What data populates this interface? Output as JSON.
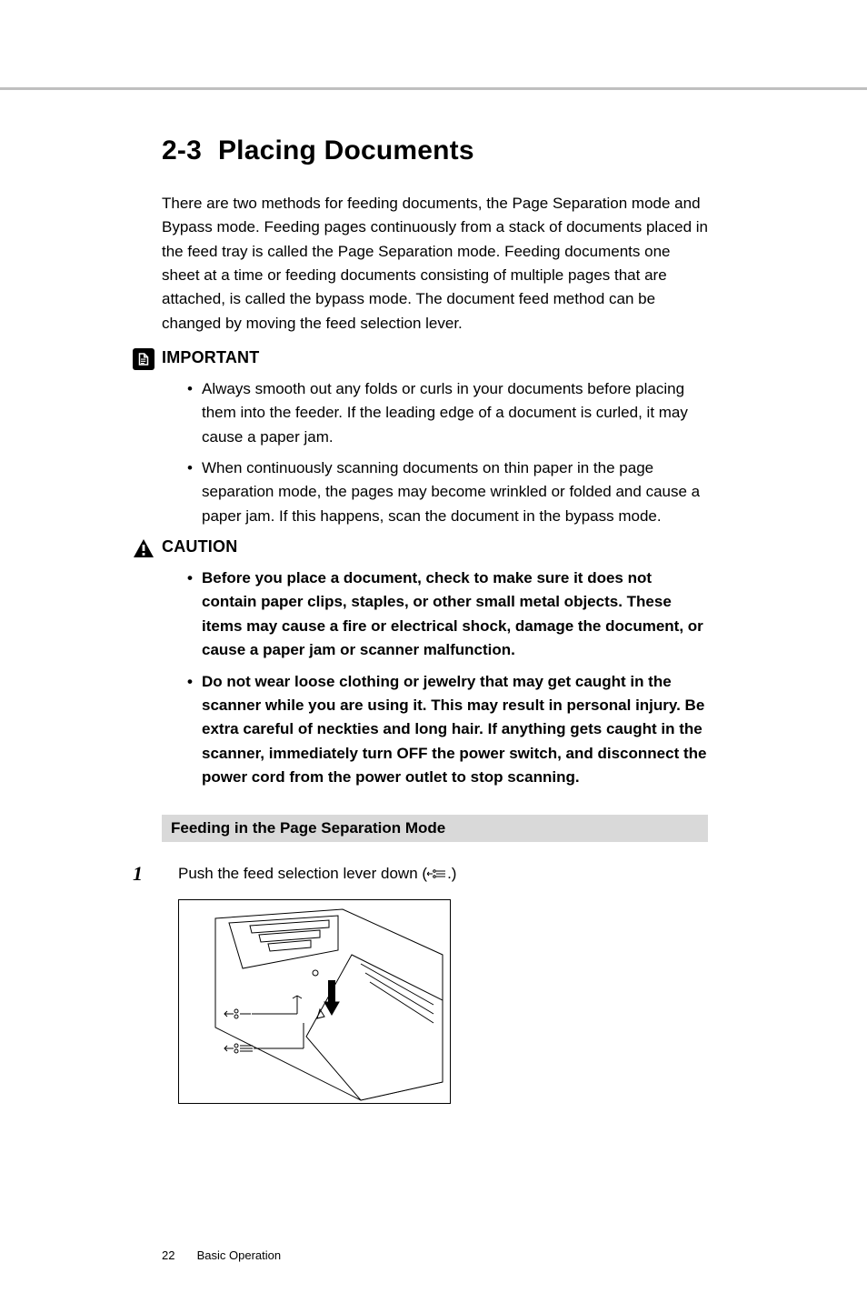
{
  "heading": {
    "number": "2-3",
    "title": "Placing Documents"
  },
  "intro": "There are two methods for feeding documents, the Page Separation mode and Bypass mode. Feeding pages continuously from a stack of documents placed in the feed tray is called the Page Separation mode. Feeding documents one sheet at a time or feeding documents consisting of multiple pages that are attached, is called the bypass mode. The document feed method can be changed by moving the feed selection lever.",
  "important": {
    "label": "IMPORTANT",
    "items": [
      "Always smooth out any folds or curls in your documents before placing them into the feeder. If the leading edge of a document is curled, it may cause a paper jam.",
      "When continuously scanning documents on thin paper in the page separation mode, the pages may become wrinkled or folded and cause a paper jam. If this happens, scan the document in the bypass mode."
    ]
  },
  "caution": {
    "label": "CAUTION",
    "items": [
      "Before you place a document, check to make sure it does not contain paper clips, staples, or other small metal objects. These items may cause a fire or electrical shock, damage the document, or cause a paper jam or scanner malfunction.",
      "Do not wear loose clothing or jewelry that may get caught in the scanner while you are using it. This may result in personal injury. Be extra careful of neckties and long hair. If anything gets caught in the scanner, immediately turn OFF the power switch, and disconnect the power cord from the power outlet to stop scanning."
    ]
  },
  "subheading": "Feeding in the Page Separation Mode",
  "step1": {
    "number": "1",
    "text_before": "Push the feed selection lever down (",
    "text_after": ".)"
  },
  "footer": {
    "page_number": "22",
    "section": "Basic Operation"
  }
}
